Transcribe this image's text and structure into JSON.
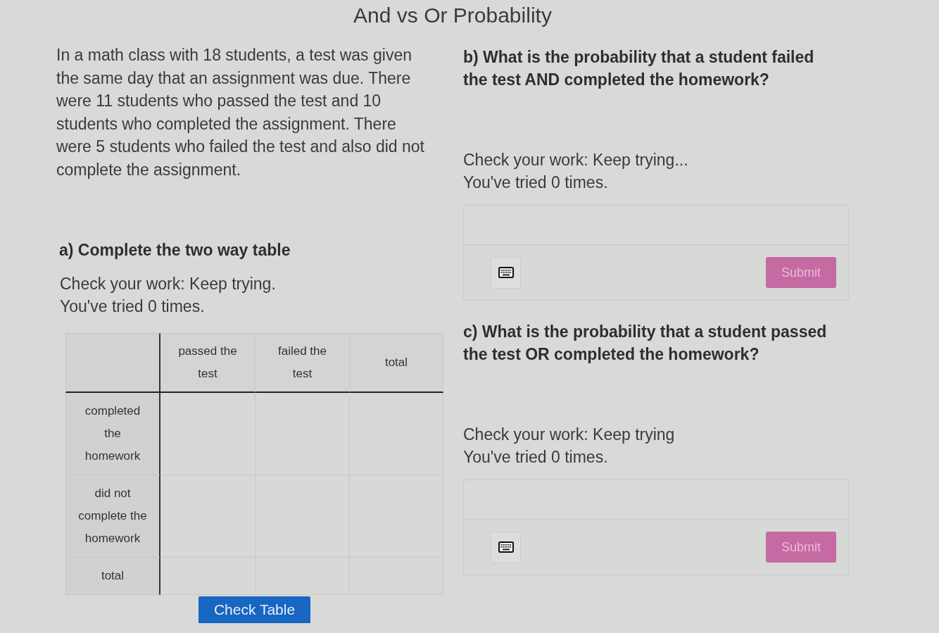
{
  "title": "And vs Or Probability",
  "problem": "In a math class with 18 students, a test was given the same day that an assignment was due. There were 11 students who passed the test and 10 students who completed the assignment. There were 5 students who failed the test and also did not complete the assignment.",
  "part_a": {
    "heading": "a) Complete the two way table",
    "feedback": "Check your work: Keep trying.",
    "attempts": "You've tried 0 times.",
    "table": {
      "columns": [
        "passed the test",
        "failed the test",
        "total"
      ],
      "rows": [
        "completed the homework",
        "did not complete the homework",
        "total"
      ]
    },
    "check_button": "Check Table"
  },
  "questions": [
    {
      "prompt": "b) What is the probability that a student failed the test AND completed the homework?",
      "feedback": "Check your work: Keep trying...",
      "attempts": "You've tried 0 times.",
      "submit": {
        "label": "Submit",
        "disabled": true
      }
    },
    {
      "prompt": "c) What is the probability that a student passed the test OR completed the homework?",
      "feedback": "Check your work: Keep trying",
      "attempts": "You've tried 0 times.",
      "submit": {
        "label": "Submit",
        "disabled": true
      }
    }
  ]
}
